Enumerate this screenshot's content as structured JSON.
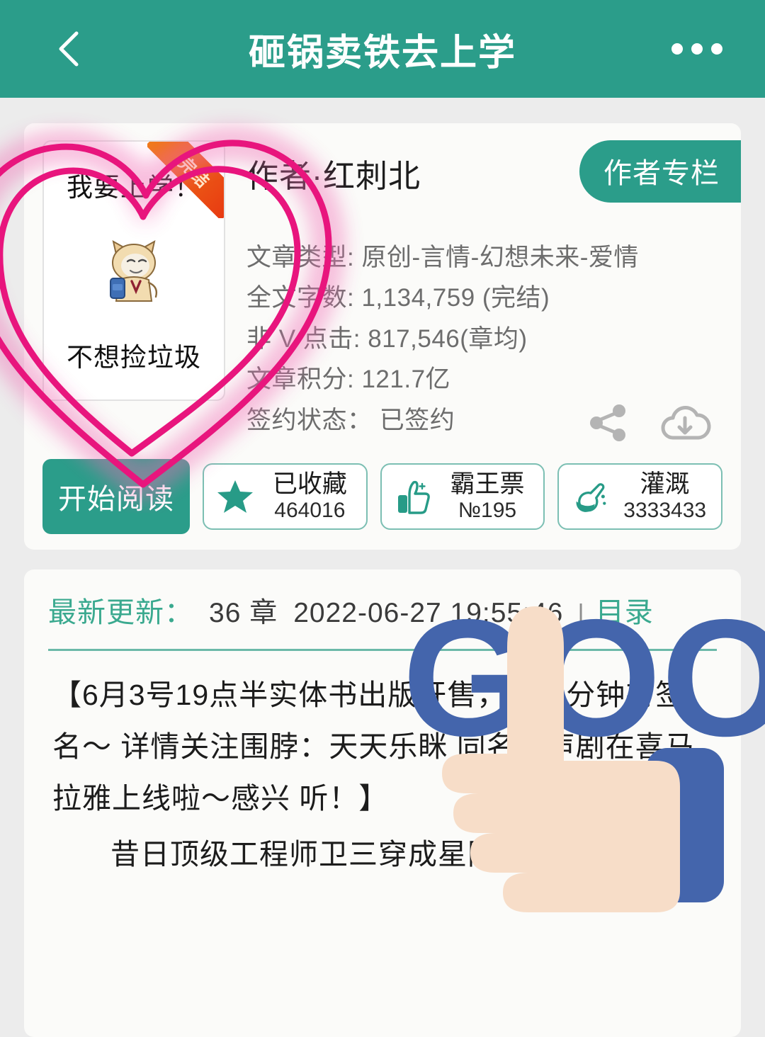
{
  "header": {
    "title": "砸锅卖铁去上学",
    "back_icon": "chevron-left-icon",
    "more_icon": "ellipsis-icon",
    "bg_color": "#2b9d8a"
  },
  "book": {
    "cover": {
      "top_text": "我要上学！",
      "bottom_text": "不想捡垃圾",
      "mascot_icon": "cat-with-backpack-icon",
      "ribbon_label": "完结",
      "ribbon_color": "#e83a12"
    },
    "author_label": "作者·红刺北",
    "author_column_button": "作者专栏",
    "meta": [
      "文章类型: 原创-言情-幻想未来-爱情",
      "全文字数: 1,134,759 (完结)",
      "非 V 点击: 817,546(章均)",
      "文章积分: 121.7亿",
      "签约状态： 已签约"
    ],
    "share_icon": "share-icon",
    "download_icon": "cloud-download-icon"
  },
  "actions": {
    "read_button": "开始阅读",
    "stats": [
      {
        "icon": "star-icon",
        "label": "已收藏",
        "value": "464016"
      },
      {
        "icon": "thumbs-up-icon",
        "label": "霸王票",
        "value": "№195"
      },
      {
        "icon": "watering-flask-icon",
        "label": "灌溉",
        "value": "3333433"
      }
    ]
  },
  "update": {
    "label": "最新更新：",
    "chapter": "36 章",
    "datetime": "2022-06-27 19:55:46",
    "separator": "|",
    "catalog_link": "目录"
  },
  "content": {
    "paragraphs": [
      "【6月3号19点半实体书出版开售，前两分钟有签名～ 详情关注围脖：天天乐眯 同名有声剧在喜马拉雅上线啦～感兴 听！】",
      "昔日顶级工程师卫三穿成星际失学儿童，靠"
    ]
  },
  "stickers": {
    "heart": {
      "name": "hand-drawn-heart",
      "color": "#e8157d"
    },
    "good": {
      "name": "thumbs-up-good-sticker",
      "text": "GOOD",
      "color": "#4465ac",
      "hand_color": "#f7ddc8"
    }
  },
  "theme": {
    "teal": "#2b9d8a",
    "page_bg": "#ececec",
    "card_bg": "#fbfbf9"
  }
}
